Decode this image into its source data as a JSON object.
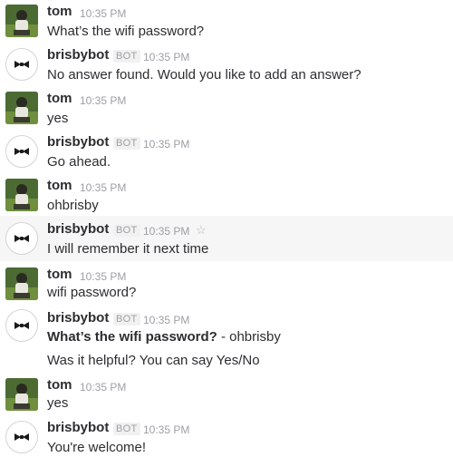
{
  "messages": [
    {
      "author": "tom",
      "is_bot": false,
      "time": "10:35 PM",
      "text": "What’s the wifi password?"
    },
    {
      "author": "brisbybot",
      "is_bot": true,
      "badge": "BOT",
      "time": "10:35 PM",
      "text": "No answer found. Would you like to add an answer?"
    },
    {
      "author": "tom",
      "is_bot": false,
      "time": "10:35 PM",
      "text": "yes"
    },
    {
      "author": "brisbybot",
      "is_bot": true,
      "badge": "BOT",
      "time": "10:35 PM",
      "text": "Go ahead."
    },
    {
      "author": "tom",
      "is_bot": false,
      "time": "10:35 PM",
      "text": "ohbrisby"
    },
    {
      "author": "brisbybot",
      "is_bot": true,
      "badge": "BOT",
      "time": "10:35 PM",
      "text": "I will remember it next time",
      "highlighted": true,
      "star_icon": "star-outline-icon"
    },
    {
      "author": "tom",
      "is_bot": false,
      "time": "10:35 PM",
      "text": "wifi password?"
    },
    {
      "author": "brisbybot",
      "is_bot": true,
      "badge": "BOT",
      "time": "10:35 PM",
      "answer_question": "What’s the wifi password?",
      "answer_value": " - ohbrisby",
      "followup": "Was it helpful? You can say Yes/No"
    },
    {
      "author": "tom",
      "is_bot": false,
      "time": "10:35 PM",
      "text": "yes"
    },
    {
      "author": "brisbybot",
      "is_bot": true,
      "badge": "BOT",
      "time": "10:35 PM",
      "text": "You're welcome!"
    }
  ],
  "icons": {
    "user_avatar": "user-photo-avatar",
    "bot_avatar": "bowtie-icon"
  },
  "colors": {
    "name": "#2c2d30",
    "meta": "#9e9ea6",
    "highlight": "#f6f6f6",
    "badge_bg": "#f1f1f1"
  }
}
